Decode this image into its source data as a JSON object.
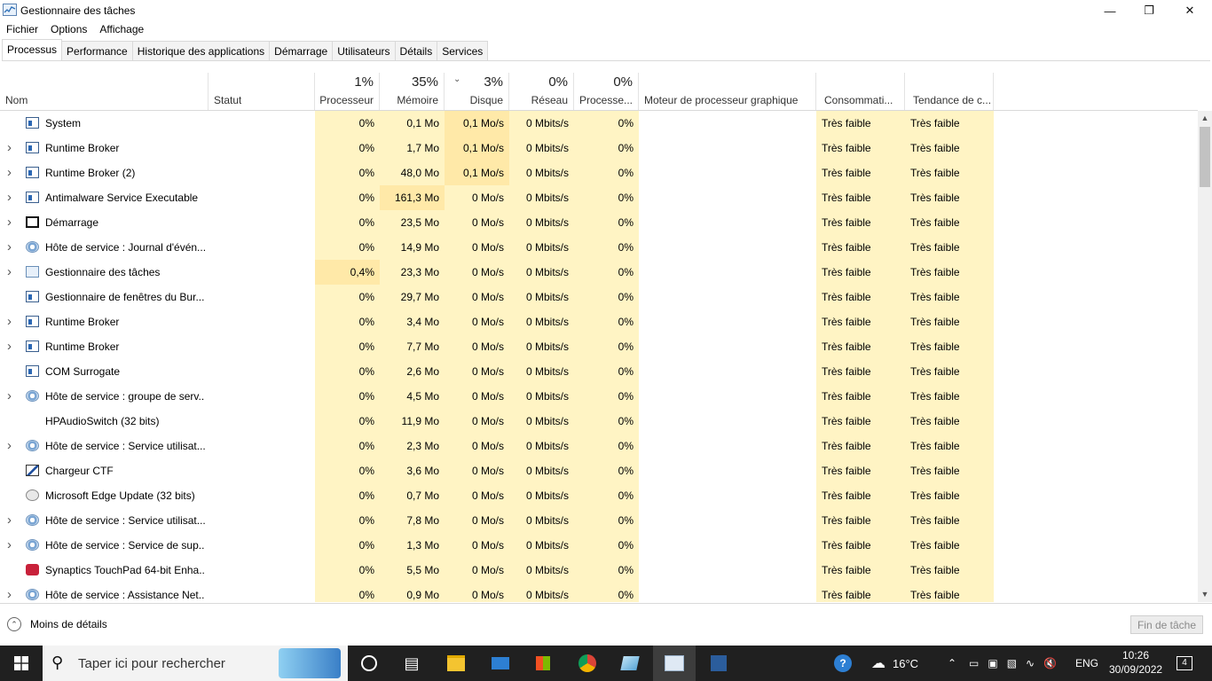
{
  "window": {
    "title": "Gestionnaire des tâches",
    "minimize": "—",
    "restore": "❐",
    "close": "✕"
  },
  "menu": [
    "Fichier",
    "Options",
    "Affichage"
  ],
  "tabs": [
    "Processus",
    "Performance",
    "Historique des applications",
    "Démarrage",
    "Utilisateurs",
    "Détails",
    "Services"
  ],
  "columns": {
    "name": "Nom",
    "status": "Statut",
    "cpu": {
      "pct": "1%",
      "label": "Processeur"
    },
    "mem": {
      "pct": "35%",
      "label": "Mémoire"
    },
    "disk": {
      "pct": "3%",
      "label": "Disque"
    },
    "net": {
      "pct": "0%",
      "label": "Réseau"
    },
    "gpu": {
      "pct": "0%",
      "label": "Processe..."
    },
    "gpu_engine": "Moteur de processeur graphique",
    "power": "Consommati...",
    "power_trend": "Tendance de c..."
  },
  "rows": [
    {
      "expand": false,
      "icon": "window",
      "name": "System",
      "cpu": "0%",
      "mem": "0,1 Mo",
      "disk": "0,1 Mo/s",
      "net": "0 Mbits/s",
      "gpu": "0%",
      "power": "Très faible",
      "trend": "Très faible"
    },
    {
      "expand": true,
      "icon": "window",
      "name": "Runtime Broker",
      "cpu": "0%",
      "mem": "1,7 Mo",
      "disk": "0,1 Mo/s",
      "net": "0 Mbits/s",
      "gpu": "0%",
      "power": "Très faible",
      "trend": "Très faible"
    },
    {
      "expand": true,
      "icon": "window",
      "name": "Runtime Broker (2)",
      "cpu": "0%",
      "mem": "48,0 Mo",
      "disk": "0,1 Mo/s",
      "net": "0 Mbits/s",
      "gpu": "0%",
      "power": "Très faible",
      "trend": "Très faible"
    },
    {
      "expand": true,
      "icon": "window",
      "name": "Antimalware Service Executable",
      "cpu": "0%",
      "mem": "161,3 Mo",
      "disk": "0 Mo/s",
      "net": "0 Mbits/s",
      "gpu": "0%",
      "power": "Très faible",
      "trend": "Très faible"
    },
    {
      "expand": true,
      "icon": "start",
      "name": "Démarrage",
      "cpu": "0%",
      "mem": "23,5 Mo",
      "disk": "0 Mo/s",
      "net": "0 Mbits/s",
      "gpu": "0%",
      "power": "Très faible",
      "trend": "Très faible"
    },
    {
      "expand": true,
      "icon": "gear",
      "name": "Hôte de service : Journal d'évén...",
      "cpu": "0%",
      "mem": "14,9 Mo",
      "disk": "0 Mo/s",
      "net": "0 Mbits/s",
      "gpu": "0%",
      "power": "Très faible",
      "trend": "Très faible"
    },
    {
      "expand": true,
      "icon": "tm",
      "name": "Gestionnaire des tâches",
      "cpu": "0,4%",
      "mem": "23,3 Mo",
      "disk": "0 Mo/s",
      "net": "0 Mbits/s",
      "gpu": "0%",
      "power": "Très faible",
      "trend": "Très faible"
    },
    {
      "expand": false,
      "icon": "window",
      "name": "Gestionnaire de fenêtres du Bur...",
      "cpu": "0%",
      "mem": "29,7 Mo",
      "disk": "0 Mo/s",
      "net": "0 Mbits/s",
      "gpu": "0%",
      "power": "Très faible",
      "trend": "Très faible"
    },
    {
      "expand": true,
      "icon": "window",
      "name": "Runtime Broker",
      "cpu": "0%",
      "mem": "3,4 Mo",
      "disk": "0 Mo/s",
      "net": "0 Mbits/s",
      "gpu": "0%",
      "power": "Très faible",
      "trend": "Très faible"
    },
    {
      "expand": true,
      "icon": "window",
      "name": "Runtime Broker",
      "cpu": "0%",
      "mem": "7,7 Mo",
      "disk": "0 Mo/s",
      "net": "0 Mbits/s",
      "gpu": "0%",
      "power": "Très faible",
      "trend": "Très faible"
    },
    {
      "expand": false,
      "icon": "window",
      "name": "COM Surrogate",
      "cpu": "0%",
      "mem": "2,6 Mo",
      "disk": "0 Mo/s",
      "net": "0 Mbits/s",
      "gpu": "0%",
      "power": "Très faible",
      "trend": "Très faible"
    },
    {
      "expand": true,
      "icon": "gear",
      "name": "Hôte de service : groupe de serv...",
      "cpu": "0%",
      "mem": "4,5 Mo",
      "disk": "0 Mo/s",
      "net": "0 Mbits/s",
      "gpu": "0%",
      "power": "Très faible",
      "trend": "Très faible"
    },
    {
      "expand": false,
      "icon": "none",
      "name": "HPAudioSwitch (32 bits)",
      "cpu": "0%",
      "mem": "11,9 Mo",
      "disk": "0 Mo/s",
      "net": "0 Mbits/s",
      "gpu": "0%",
      "power": "Très faible",
      "trend": "Très faible"
    },
    {
      "expand": true,
      "icon": "gear",
      "name": "Hôte de service : Service utilisat...",
      "cpu": "0%",
      "mem": "2,3 Mo",
      "disk": "0 Mo/s",
      "net": "0 Mbits/s",
      "gpu": "0%",
      "power": "Très faible",
      "trend": "Très faible"
    },
    {
      "expand": false,
      "icon": "ctf",
      "name": "Chargeur CTF",
      "cpu": "0%",
      "mem": "3,6 Mo",
      "disk": "0 Mo/s",
      "net": "0 Mbits/s",
      "gpu": "0%",
      "power": "Très faible",
      "trend": "Très faible"
    },
    {
      "expand": false,
      "icon": "edge",
      "name": "Microsoft Edge Update (32 bits)",
      "cpu": "0%",
      "mem": "0,7 Mo",
      "disk": "0 Mo/s",
      "net": "0 Mbits/s",
      "gpu": "0%",
      "power": "Très faible",
      "trend": "Très faible"
    },
    {
      "expand": true,
      "icon": "gear",
      "name": "Hôte de service : Service utilisat...",
      "cpu": "0%",
      "mem": "7,8 Mo",
      "disk": "0 Mo/s",
      "net": "0 Mbits/s",
      "gpu": "0%",
      "power": "Très faible",
      "trend": "Très faible"
    },
    {
      "expand": true,
      "icon": "gear",
      "name": "Hôte de service : Service de sup...",
      "cpu": "0%",
      "mem": "1,3 Mo",
      "disk": "0 Mo/s",
      "net": "0 Mbits/s",
      "gpu": "0%",
      "power": "Très faible",
      "trend": "Très faible"
    },
    {
      "expand": false,
      "icon": "syn",
      "name": "Synaptics TouchPad 64-bit Enha...",
      "cpu": "0%",
      "mem": "5,5 Mo",
      "disk": "0 Mo/s",
      "net": "0 Mbits/s",
      "gpu": "0%",
      "power": "Très faible",
      "trend": "Très faible"
    },
    {
      "expand": true,
      "icon": "gear",
      "name": "Hôte de service : Assistance Net...",
      "cpu": "0%",
      "mem": "0,9 Mo",
      "disk": "0 Mo/s",
      "net": "0 Mbits/s",
      "gpu": "0%",
      "power": "Très faible",
      "trend": "Très faible"
    }
  ],
  "footer": {
    "less_details": "Moins de détails",
    "end_task": "Fin de tâche"
  },
  "taskbar": {
    "search_placeholder": "Taper ici pour rechercher",
    "weather": "16°C",
    "lang": "ENG",
    "time": "10:26",
    "date": "30/09/2022",
    "notifications": "4"
  },
  "colors": {
    "heat": "#fff4c4",
    "heat_strong": "#ffe9a8",
    "taskbar": "#202020"
  }
}
